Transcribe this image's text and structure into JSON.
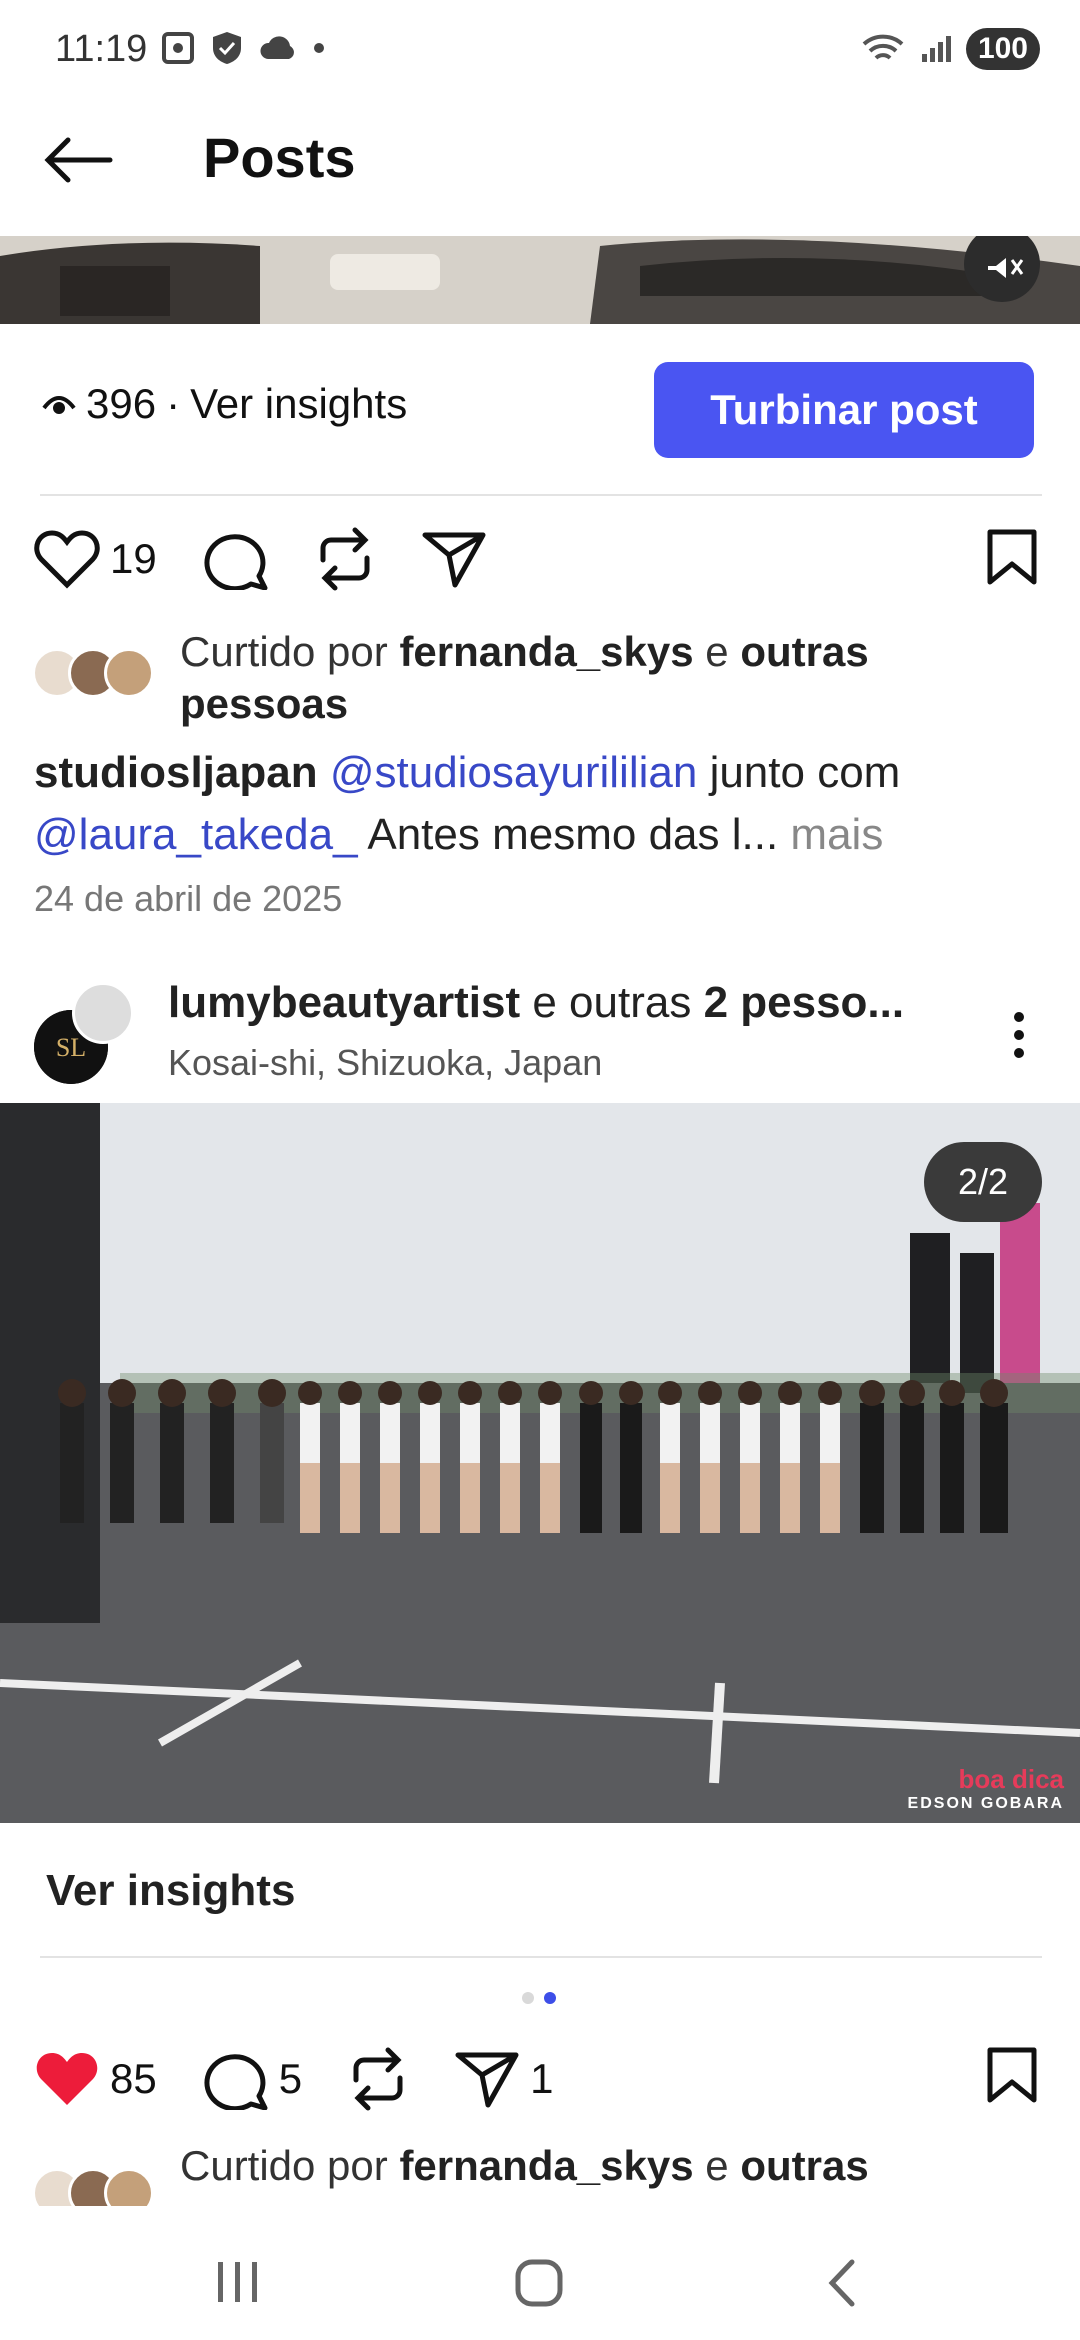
{
  "status_bar": {
    "time": "11:19",
    "battery": "100"
  },
  "header": {
    "title": "Posts"
  },
  "post1": {
    "views": "396",
    "views_sep": "·",
    "views_link": "Ver insights",
    "boost_button": "Turbinar post",
    "likes": "19",
    "liked_prefix": "Curtido por",
    "liked_user": "fernanda_skys",
    "liked_and": "e",
    "liked_others": "outras pessoas",
    "caption_user": "studiosljapan",
    "caption_mention1": "@studiosayurililian",
    "caption_text1": "junto com",
    "caption_mention2": "@laura_takeda_",
    "caption_text2": "Antes mesmo das l...",
    "caption_more": "mais",
    "date": "24 de abril de 2025"
  },
  "post2": {
    "author": "lumybeautyartist",
    "author_and": "e outras",
    "author_others": "2 pesso...",
    "location": "Kosai-shi, Shizuoka, Japan",
    "counter": "2/2",
    "watermark": "boa dica",
    "watermark_sub": "EDSON GOBARA",
    "insights_link": "Ver insights",
    "likes": "85",
    "comments": "5",
    "shares": "1",
    "liked_prefix": "Curtido por",
    "liked_user": "fernanda_skys",
    "liked_and": "e",
    "liked_others": "outras"
  },
  "colors": {
    "accent": "#4a55f2",
    "mention": "#3848c7",
    "like_red": "#ed1c3a"
  }
}
